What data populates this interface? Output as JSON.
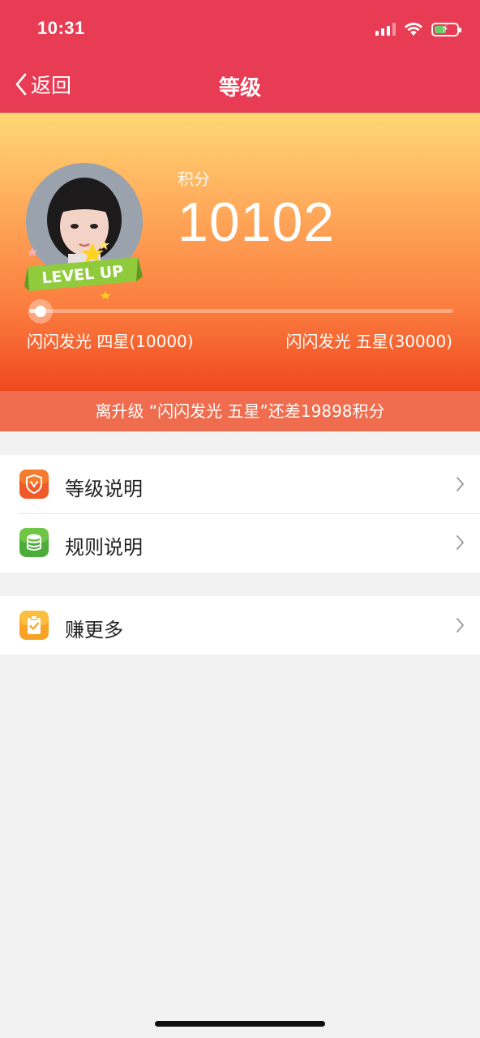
{
  "status_bar": {
    "time": "10:31"
  },
  "nav": {
    "back_label": "返回",
    "title": "等级"
  },
  "hero": {
    "score_label": "积分",
    "score": "10102",
    "badge_text": "LEVEL UP",
    "current_level": "闪闪发光 四星(10000)",
    "next_level": "闪闪发光 五星(30000)",
    "progress": 0.0051
  },
  "hint": "离升级 “闪闪发光 五星”还差19898积分",
  "menu": {
    "level_desc": "等级说明",
    "rules_desc": "规则说明",
    "earn_more": "赚更多"
  },
  "colors": {
    "header": "#e83c54",
    "hint_bar": "#ef6c4f",
    "icon_level": "#f05a28",
    "icon_rules": "#4cae3a",
    "icon_earn": "#f7a325"
  }
}
